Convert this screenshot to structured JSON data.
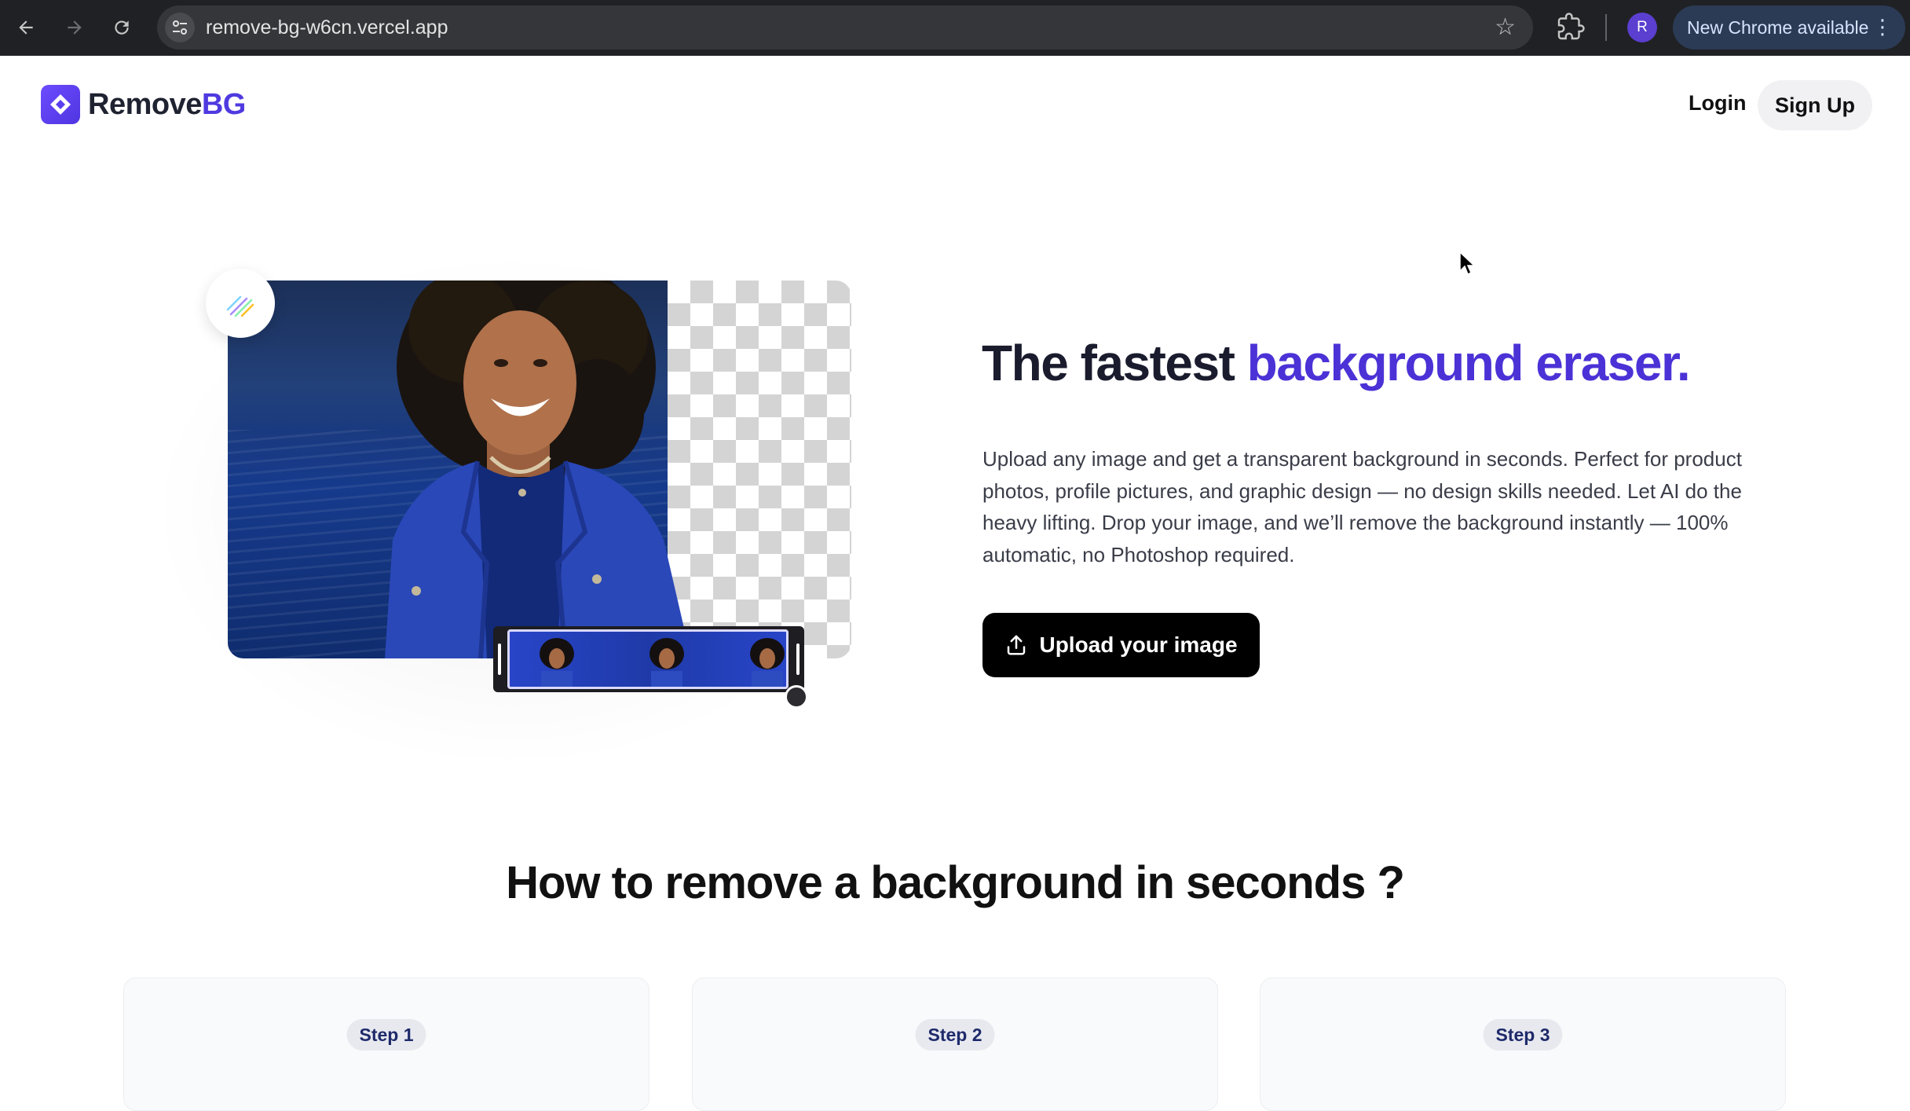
{
  "browser": {
    "url": "remove-bg-w6cn.vercel.app",
    "profile_initial": "R",
    "update_label": "New Chrome available",
    "icons": [
      "back-arrow-icon",
      "forward-arrow-icon",
      "reload-icon",
      "site-settings-icon",
      "bookmark-star-icon",
      "extensions-icon",
      "more-vert-icon"
    ]
  },
  "header": {
    "brand_part1": "Remove",
    "brand_part2": "BG",
    "login_label": "Login",
    "signup_label": "Sign Up"
  },
  "hero": {
    "title_part1": "The fastest ",
    "title_part2": "background eraser.",
    "description": "Upload any image and get a transparent background in seconds. Perfect for product photos, profile pictures, and graphic design — no design skills needed. Let AI do the heavy lifting. Drop your image, and we’ll remove the background instantly — 100% automatic, no Photoshop required.",
    "upload_label": "Upload your image"
  },
  "howto": {
    "title": "How to remove a background in seconds ?",
    "steps": [
      {
        "label": "Step 1"
      },
      {
        "label": "Step 2"
      },
      {
        "label": "Step 3"
      }
    ]
  },
  "colors": {
    "brand_accent": "#4b32d6",
    "chrome_bg": "#202124",
    "button_bg": "#000000"
  }
}
